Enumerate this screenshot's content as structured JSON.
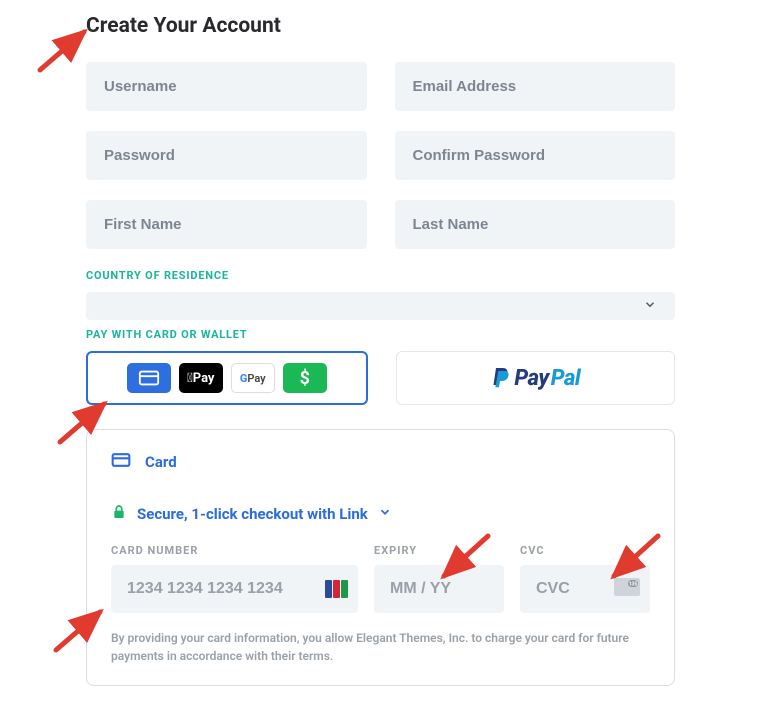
{
  "title": "Create Your Account",
  "fields": {
    "username_ph": "Username",
    "email_ph": "Email Address",
    "password_ph": "Password",
    "confirm_ph": "Confirm Password",
    "first_ph": "First Name",
    "last_ph": "Last Name"
  },
  "country": {
    "label": "COUNTRY OF RESIDENCE",
    "value": ""
  },
  "pay": {
    "label": "PAY WITH CARD OR WALLET",
    "apple": "Pay",
    "google_g": "G",
    "google_pay": " Pay",
    "cash": "$",
    "paypal_dark": "Pay",
    "paypal_light": "Pal"
  },
  "card": {
    "tab_label": "Card",
    "link_text": "Secure, 1-click checkout with Link",
    "number_label": "CARD NUMBER",
    "number_ph": "1234 1234 1234 1234",
    "expiry_label": "EXPIRY",
    "expiry_ph": "MM / YY",
    "cvc_label": "CVC",
    "cvc_ph": "CVC",
    "disclaimer": "By providing your card information, you allow Elegant Themes, Inc. to charge your card for future payments in accordance with their terms."
  },
  "colors": {
    "arrow": "#e13b30",
    "jcb": [
      "#2a4b9b",
      "#d3263b",
      "#1a9a4a"
    ]
  }
}
